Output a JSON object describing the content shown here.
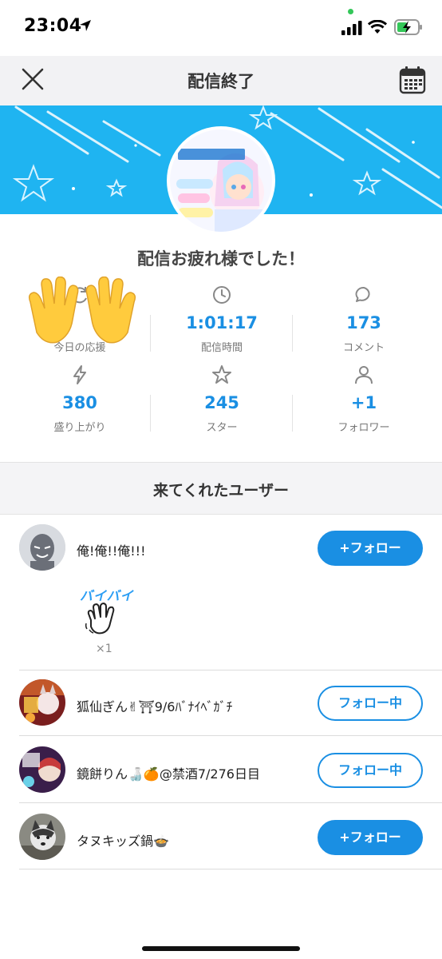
{
  "status_bar": {
    "time": "23:04"
  },
  "header": {
    "title": "配信終了"
  },
  "thanks_message": "配信お疲れ様でした！",
  "stats": [
    {
      "label": "今日の応援",
      "value": "",
      "icon": "hands-emoji"
    },
    {
      "label": "配信時間",
      "value": "1:01:17",
      "icon": "clock-icon"
    },
    {
      "label": "コメント",
      "value": "173",
      "icon": "chat-bubble-icon"
    },
    {
      "label": "盛り上がり",
      "value": "380",
      "icon": "lightning-icon"
    },
    {
      "label": "スター",
      "value": "245",
      "icon": "star-icon"
    },
    {
      "label": "フォロワー",
      "value": "+1",
      "icon": "person-icon"
    }
  ],
  "section_title": "来てくれたユーザー",
  "users": [
    {
      "name": "俺!俺!!俺!!!",
      "button": "+フォロー",
      "state": "follow"
    },
    {
      "name": "狐仙ぎん✌⛩9/6ﾊﾞﾅｲﾍﾞｶﾞﾁ",
      "button": "フォロー中",
      "state": "following"
    },
    {
      "name": "鏡餅りん🍶🍊@禁酒7/276日目",
      "button": "フォロー中",
      "state": "following"
    },
    {
      "name": "タヌキッズ鍋🍲",
      "button": "+フォロー",
      "state": "follow"
    }
  ],
  "gift": {
    "label": "バイバイ",
    "count": "×1",
    "icon": "waving-hand-icon"
  },
  "colors": {
    "accent": "#1a8fe3",
    "banner": "#1fb4f1"
  }
}
